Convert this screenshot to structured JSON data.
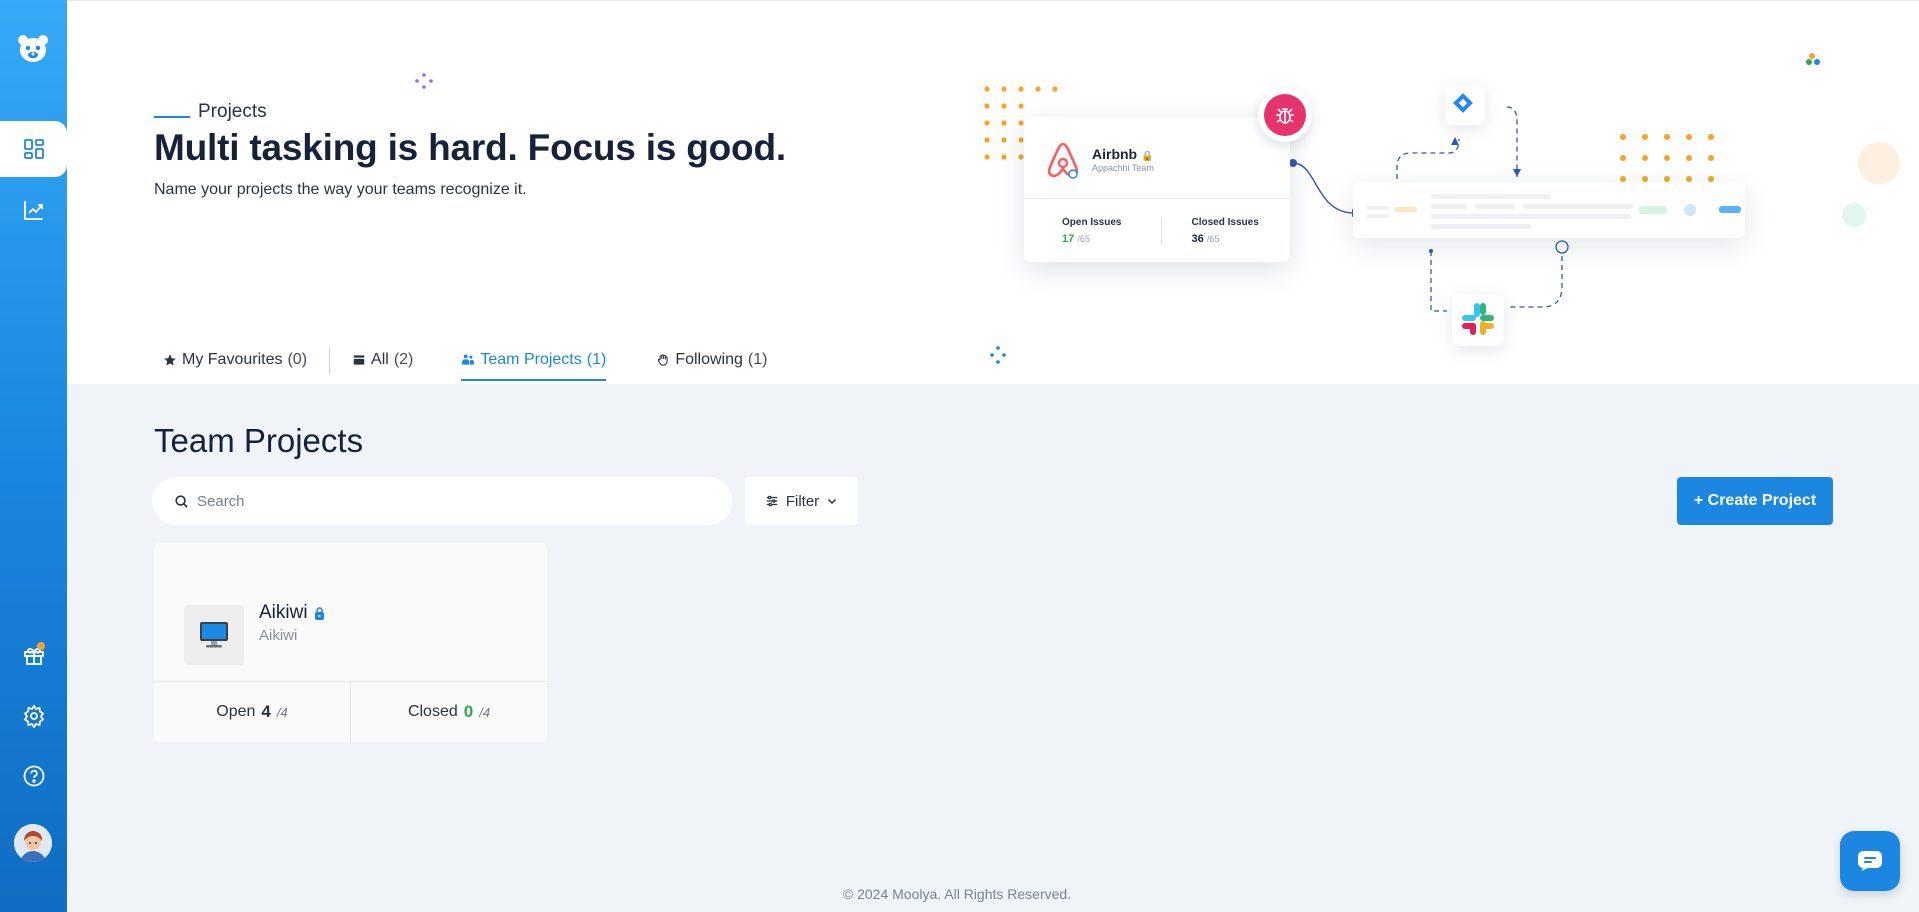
{
  "sidebar": {
    "items": [
      {
        "name": "dashboard",
        "icon": "grid-icon"
      },
      {
        "name": "reports",
        "icon": "chart-trend-icon"
      },
      {
        "name": "gifts",
        "icon": "gift-icon"
      },
      {
        "name": "settings",
        "icon": "gear-icon"
      },
      {
        "name": "help",
        "icon": "help-circle-icon"
      }
    ]
  },
  "hero": {
    "eyebrow": "Projects",
    "title": "Multi tasking is hard. Focus is good.",
    "subtitle": "Name your projects the way your teams recognize it.",
    "illustration": {
      "card_name": "Airbnb",
      "card_team": "Appachhi Team",
      "open_label": "Open Issues",
      "open_value": "17",
      "open_total": "/65",
      "closed_label": "Closed Issues",
      "closed_value": "36",
      "closed_total": "/65"
    }
  },
  "tabs": [
    {
      "label": "My Favourites",
      "count": "(0)",
      "icon": "star-icon"
    },
    {
      "label": "All",
      "count": "(2)",
      "icon": "folder-icon"
    },
    {
      "label": "Team Projects",
      "count": "(1)",
      "icon": "team-icon",
      "active": true
    },
    {
      "label": "Following",
      "count": "(1)",
      "icon": "follow-hand-icon"
    }
  ],
  "main": {
    "title": "Team Projects",
    "search_placeholder": "Search",
    "filter_label": "Filter",
    "create_label": "+ Create Project"
  },
  "projects": [
    {
      "name": "Aikiwi",
      "subtitle": "Aikiwi",
      "open_label": "Open",
      "open_value": "4",
      "open_total": "/4",
      "closed_label": "Closed",
      "closed_value": "0",
      "closed_total": "/4"
    }
  ],
  "footer": "© 2024 Moolya. All Rights Reserved.",
  "colors": {
    "accent": "#1b87e0",
    "green": "#2fa84f",
    "orange_dots": "#f5a524",
    "bug_badge": "#e6336b"
  }
}
